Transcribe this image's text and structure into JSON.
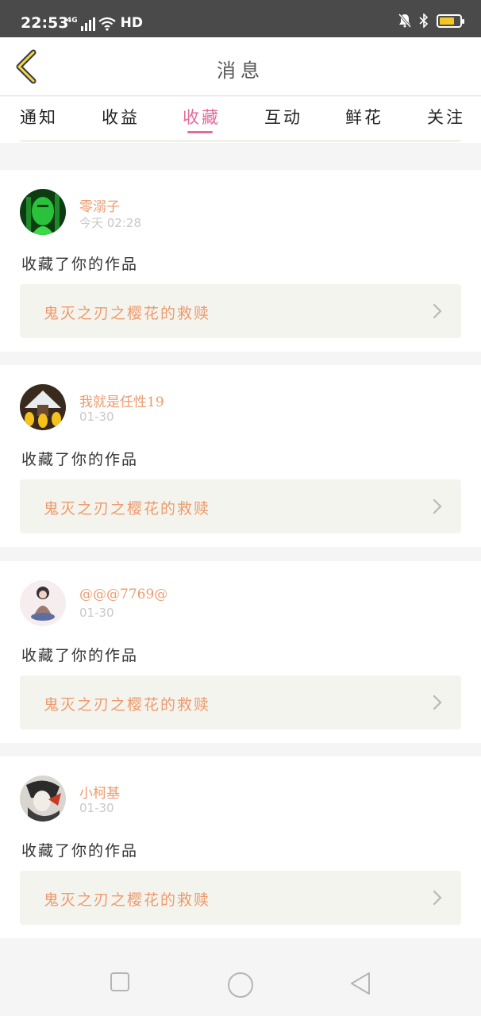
{
  "status": {
    "time": "22:53",
    "network": "4G",
    "hd": "HD",
    "battery_color": "#f3c622"
  },
  "header": {
    "back_icon": "chevron-left-icon",
    "title": "消息"
  },
  "tabs": [
    {
      "label": "通知"
    },
    {
      "label": "收益"
    },
    {
      "label": "收藏"
    },
    {
      "label": "互动"
    },
    {
      "label": "鲜花"
    },
    {
      "label": "关注"
    }
  ],
  "active_tab": "收藏",
  "accent_color": "#e36b9b",
  "name_color": "#ee9a6c",
  "messages": [
    {
      "username": "零溺子",
      "time": "今天 02:28",
      "action": "收藏了你的作品",
      "work_title": "鬼灭之刃之樱花的救赎"
    },
    {
      "username": "我就是任性19",
      "time": "01-30",
      "action": "收藏了你的作品",
      "work_title": "鬼灭之刃之樱花的救赎"
    },
    {
      "username": "@@@7769@",
      "time": "01-30",
      "action": "收藏了你的作品",
      "work_title": "鬼灭之刃之樱花的救赎"
    },
    {
      "username": "小柯基",
      "time": "01-30",
      "action": "收藏了你的作品",
      "work_title": "鬼灭之刃之樱花的救赎"
    }
  ],
  "navbar": {
    "recent_icon": "square-icon",
    "home_icon": "circle-icon",
    "back_icon": "triangle-back-icon"
  }
}
